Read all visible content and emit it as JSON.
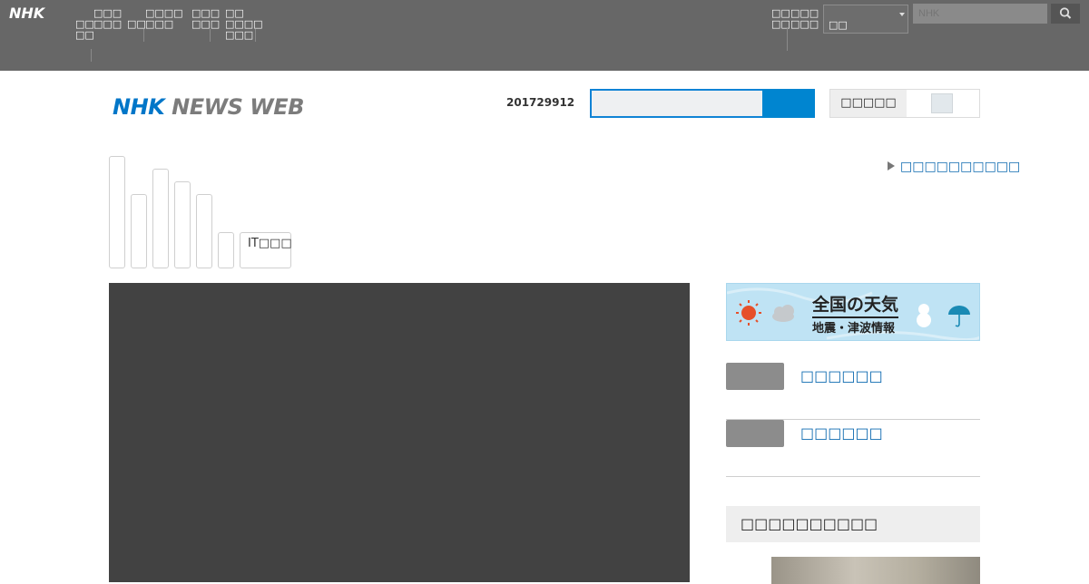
{
  "global_nav": {
    "logo": "NHK",
    "items": [
      "□□\n□□",
      "□□□\n□□□",
      "□□",
      "□□□□\n□□□",
      "□□□\n□□□",
      "□□\n□□□□\n□□□"
    ],
    "right_items": [
      "□□\n□□",
      "□□□\n□□□"
    ],
    "region": "□□",
    "search_placeholder": "NHK"
  },
  "header": {
    "brand_nhk": "NHK",
    "brand_news": "NEWS WEB",
    "date": "201729912",
    "font_size_label": "□□□□□"
  },
  "tabs": [
    {
      "label": ""
    },
    {
      "label": ""
    },
    {
      "label": ""
    },
    {
      "label": ""
    },
    {
      "label": ""
    },
    {
      "label": ""
    },
    {
      "label": "IT□□□"
    }
  ],
  "top_link": "□□□□□□□□□□",
  "sidebar": {
    "weather_title": "全国の天気",
    "weather_sub": "地震・津波情報",
    "items": [
      {
        "label": "□□□□□□"
      },
      {
        "label": "□□□□□□"
      }
    ],
    "ranking_title": "□□□□□□□□□□"
  },
  "colors": {
    "accent": "#0085d0",
    "brand_blue": "#0076c8",
    "global_bar": "#676767",
    "link": "#0e6ab0"
  }
}
